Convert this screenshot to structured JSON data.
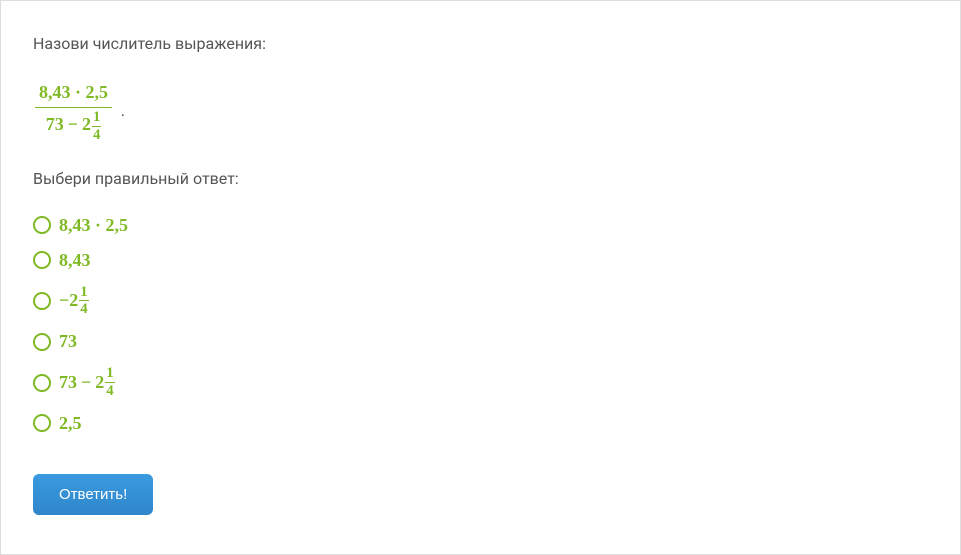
{
  "question": {
    "prompt": "Назови числитель выражения:",
    "expression": {
      "numerator": "8,43 · 2,5",
      "denominator_left": "73",
      "denominator_minus": "−",
      "denominator_whole": "2",
      "denominator_frac_num": "1",
      "denominator_frac_den": "4"
    },
    "period": ".",
    "choose_text": "Выбери правильный ответ:"
  },
  "options": {
    "opt1": "8,43 · 2,5",
    "opt2": "8,43",
    "opt3_minus": "−",
    "opt3_whole": "2",
    "opt3_num": "1",
    "opt3_den": "4",
    "opt4": "73",
    "opt5_left": "73",
    "opt5_minus": "−",
    "opt5_whole": "2",
    "opt5_num": "1",
    "opt5_den": "4",
    "opt6": "2,5"
  },
  "submit_label": "Ответить!"
}
